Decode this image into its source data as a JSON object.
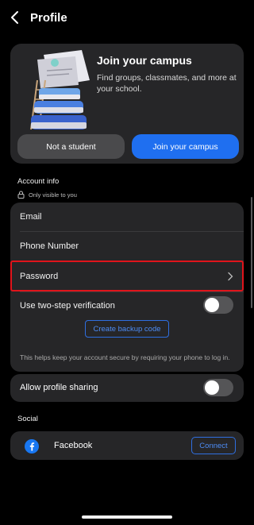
{
  "header": {
    "title": "Profile",
    "back_icon": "chevron-left-icon"
  },
  "campus": {
    "title": "Join your campus",
    "subtitle": "Find groups, classmates, and more at your school.",
    "not_student_label": "Not a student",
    "join_label": "Join your campus",
    "accent": "#1f6ff0"
  },
  "account_info": {
    "label": "Account info",
    "visibility_note": "Only visible to you",
    "email_label": "Email",
    "phone_label": "Phone Number",
    "password_label": "Password",
    "two_step_label": "Use two-step verification",
    "two_step_enabled": false,
    "backup_code_label": "Create backup code",
    "help_text": "This helps keep your account secure by requiring your phone to log in.",
    "profile_sharing_label": "Allow profile sharing",
    "profile_sharing_enabled": false,
    "highlight_color": "#e0141b"
  },
  "social": {
    "label": "Social",
    "facebook_label": "Facebook",
    "connect_label": "Connect"
  }
}
